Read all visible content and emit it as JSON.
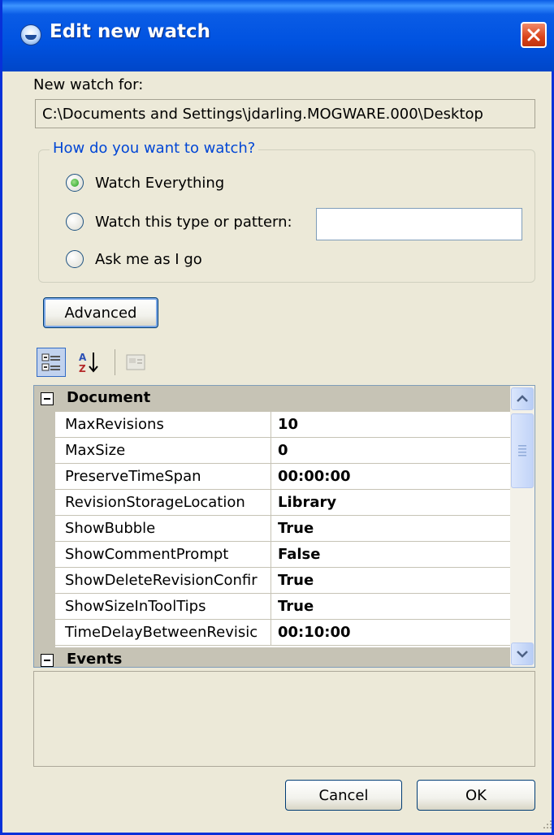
{
  "window": {
    "title": "Edit new watch"
  },
  "watch_for": {
    "label": "New watch for:",
    "path": "C:\\Documents and Settings\\jdarling.MOGWARE.000\\Desktop"
  },
  "watch_mode": {
    "legend": "How do you want to watch?",
    "options": [
      {
        "label": "Watch Everything",
        "checked": true
      },
      {
        "label": "Watch this type or pattern:",
        "checked": false
      },
      {
        "label": "Ask me as I go",
        "checked": false
      }
    ],
    "pattern_value": ""
  },
  "advanced_button": "Advanced",
  "property_toolbar": {
    "categorized_icon": "categorized-view-icon",
    "alphabetical_icon": "sort-alphabetical-icon",
    "pages_icon": "property-pages-icon"
  },
  "property_grid": {
    "categories": [
      {
        "name": "Document",
        "properties": [
          {
            "name": "MaxRevisions",
            "value": "10"
          },
          {
            "name": "MaxSize",
            "value": "0"
          },
          {
            "name": "PreserveTimeSpan",
            "value": "00:00:00"
          },
          {
            "name": "RevisionStorageLocation",
            "value": "Library"
          },
          {
            "name": "ShowBubble",
            "value": "True"
          },
          {
            "name": "ShowCommentPrompt",
            "value": "False"
          },
          {
            "name": "ShowDeleteRevisionConfir",
            "value": "True"
          },
          {
            "name": "ShowSizeInToolTips",
            "value": "True"
          },
          {
            "name": "TimeDelayBetweenRevisic",
            "value": "00:10:00"
          }
        ]
      },
      {
        "name": "Events",
        "properties": []
      }
    ]
  },
  "buttons": {
    "cancel": "Cancel",
    "ok": "OK"
  },
  "colors": {
    "titlebar": "#0052e0",
    "group_legend": "#0046d5",
    "window_bg": "#ece9d8"
  }
}
